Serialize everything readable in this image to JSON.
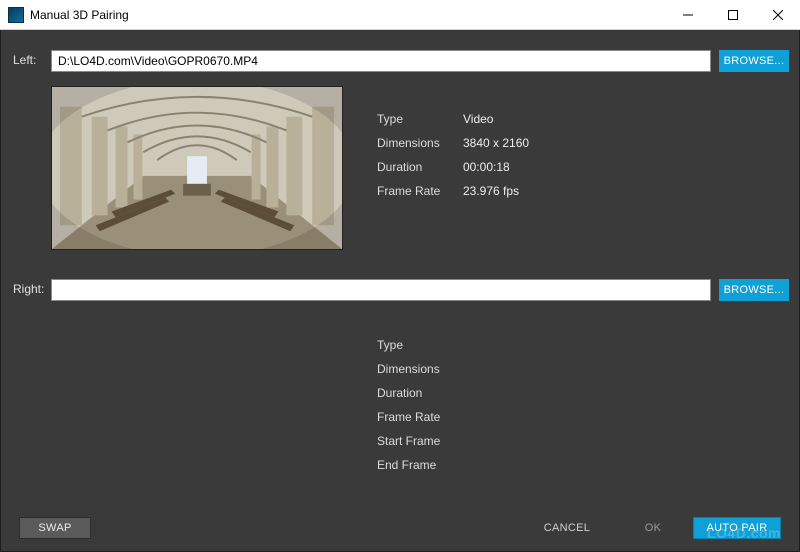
{
  "window": {
    "title": "Manual 3D Pairing"
  },
  "left": {
    "label": "Left:",
    "path": "D:\\LO4D.com\\Video\\GOPR0670.MP4",
    "browse": "BROWSE...",
    "info": {
      "type_k": "Type",
      "type_v": "Video",
      "dim_k": "Dimensions",
      "dim_v": "3840 x 2160",
      "dur_k": "Duration",
      "dur_v": "00:00:18",
      "fps_k": "Frame Rate",
      "fps_v": "23.976 fps"
    }
  },
  "right": {
    "label": "Right:",
    "path": "",
    "browse": "BROWSE...",
    "info": {
      "type_k": "Type",
      "dim_k": "Dimensions",
      "dur_k": "Duration",
      "fps_k": "Frame Rate",
      "start_k": "Start Frame",
      "end_k": "End Frame"
    }
  },
  "buttons": {
    "swap": "SWAP",
    "cancel": "CANCEL",
    "ok": "OK",
    "autopair": "AUTO PAIR"
  },
  "watermark": "LO4D.com"
}
